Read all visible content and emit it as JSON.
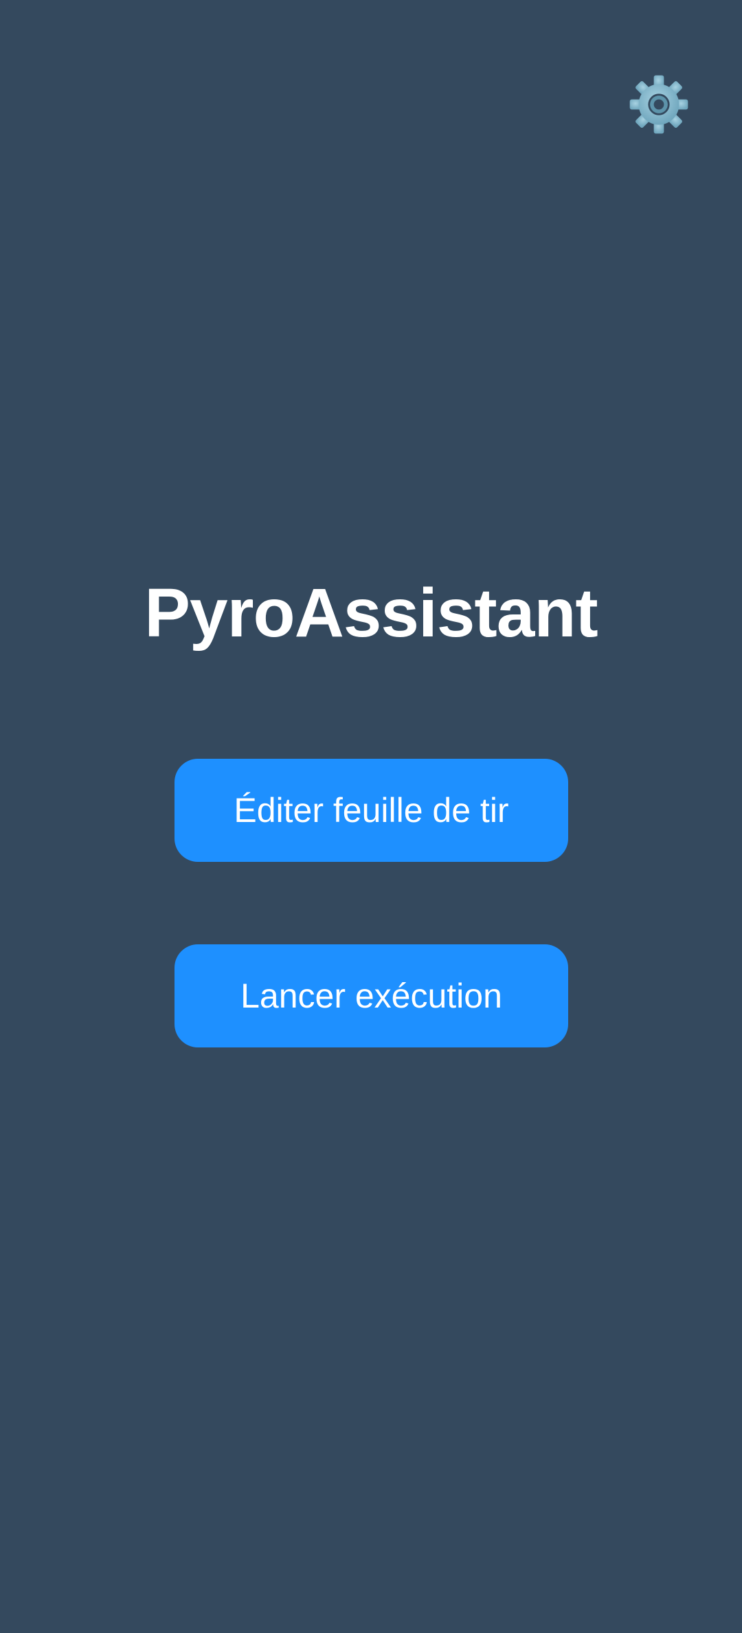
{
  "app": {
    "title": "PyroAssistant"
  },
  "toolbar": {
    "settings_icon": "gear-icon"
  },
  "actions": {
    "edit_label": "Éditer feuille de tir",
    "run_label": "Lancer exécution"
  },
  "colors": {
    "background": "#34495e",
    "button": "#1e90ff",
    "text": "#ffffff",
    "gear": "#7fb3c8"
  }
}
